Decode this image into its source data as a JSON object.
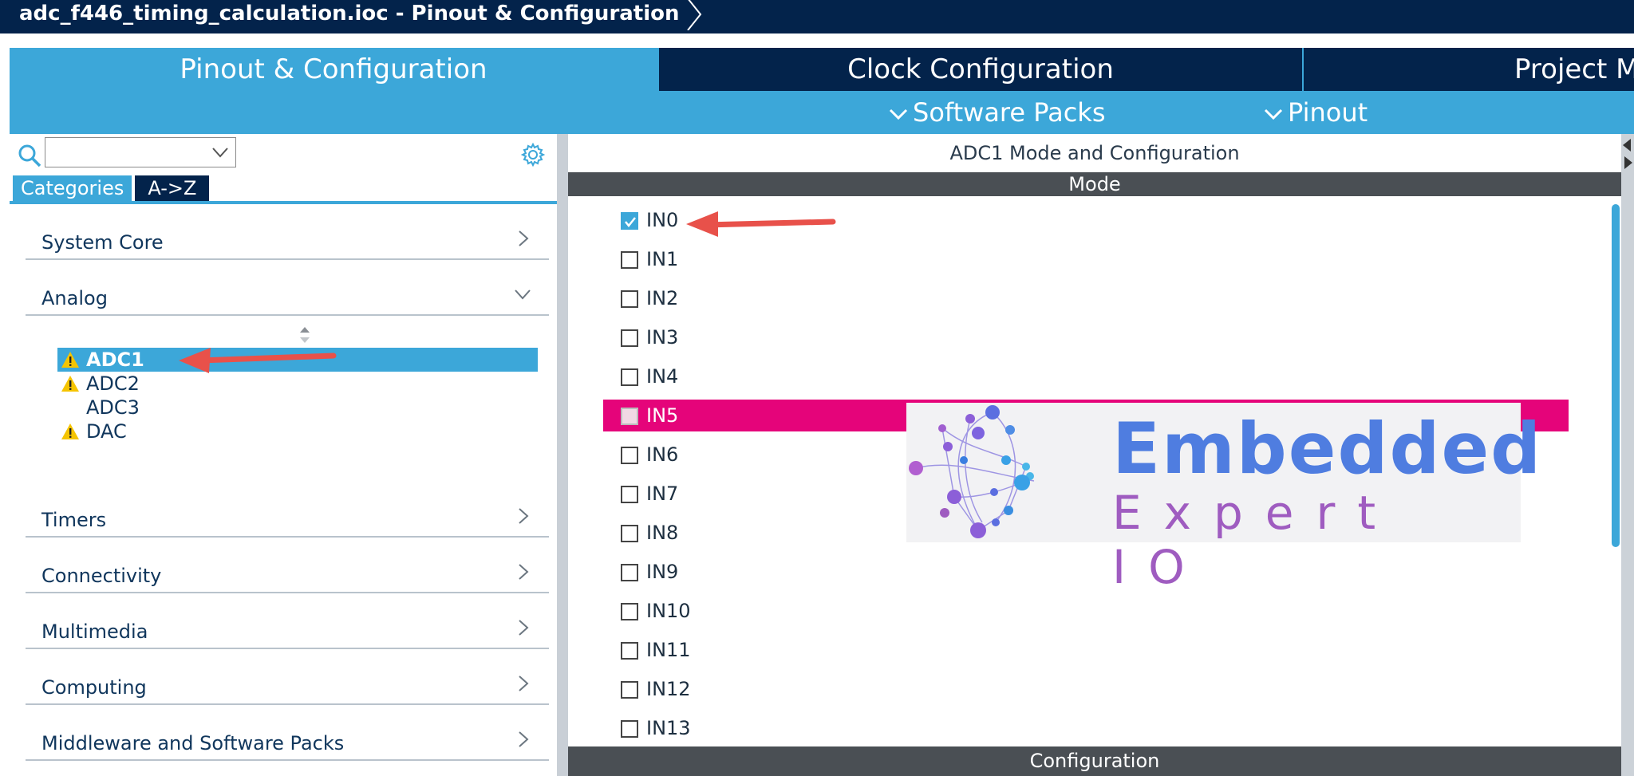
{
  "window": {
    "title": "adc_f446_timing_calculation.ioc - Pinout & Configuration"
  },
  "tabs": [
    {
      "label": "Pinout & Configuration",
      "active": true
    },
    {
      "label": "Clock Configuration",
      "active": false
    },
    {
      "label": "Project M",
      "active": false
    }
  ],
  "subtabs": [
    {
      "label": "Software Packs"
    },
    {
      "label": "Pinout"
    }
  ],
  "left": {
    "search": {
      "value": ""
    },
    "category_tabs": [
      "Categories",
      "A->Z"
    ],
    "categories": [
      {
        "label": "System Core",
        "expanded": false
      },
      {
        "label": "Analog",
        "expanded": true
      },
      {
        "label": "Timers",
        "expanded": false
      },
      {
        "label": "Connectivity",
        "expanded": false
      },
      {
        "label": "Multimedia",
        "expanded": false
      },
      {
        "label": "Computing",
        "expanded": false
      },
      {
        "label": "Middleware and Software Packs",
        "expanded": false
      }
    ],
    "analog_items": [
      {
        "label": "ADC1",
        "warning": true,
        "selected": true
      },
      {
        "label": "ADC2",
        "warning": true,
        "selected": false
      },
      {
        "label": "ADC3",
        "warning": false,
        "selected": false
      },
      {
        "label": "DAC",
        "warning": true,
        "selected": false
      }
    ]
  },
  "right": {
    "title": "ADC1 Mode and Configuration",
    "mode_header": "Mode",
    "config_header": "Configuration",
    "mode_items": [
      {
        "label": "IN0",
        "checked": true
      },
      {
        "label": "IN1",
        "checked": false
      },
      {
        "label": "IN2",
        "checked": false
      },
      {
        "label": "IN3",
        "checked": false
      },
      {
        "label": "IN4",
        "checked": false
      },
      {
        "label": "IN5",
        "checked": false,
        "highlighted": true
      },
      {
        "label": "IN6",
        "checked": false
      },
      {
        "label": "IN7",
        "checked": false
      },
      {
        "label": "IN8",
        "checked": false
      },
      {
        "label": "IN9",
        "checked": false
      },
      {
        "label": "IN10",
        "checked": false
      },
      {
        "label": "IN11",
        "checked": false
      },
      {
        "label": "IN12",
        "checked": false
      },
      {
        "label": "IN13",
        "checked": false
      }
    ]
  },
  "watermark": {
    "line1": "Embedded",
    "line2": "Expert IO"
  },
  "colors": {
    "navy": "#03234b",
    "accent_blue": "#3ca7d9",
    "highlight_pink": "#e5047a",
    "annotation_red": "#e8514a",
    "warning_yellow": "#f5c400"
  }
}
